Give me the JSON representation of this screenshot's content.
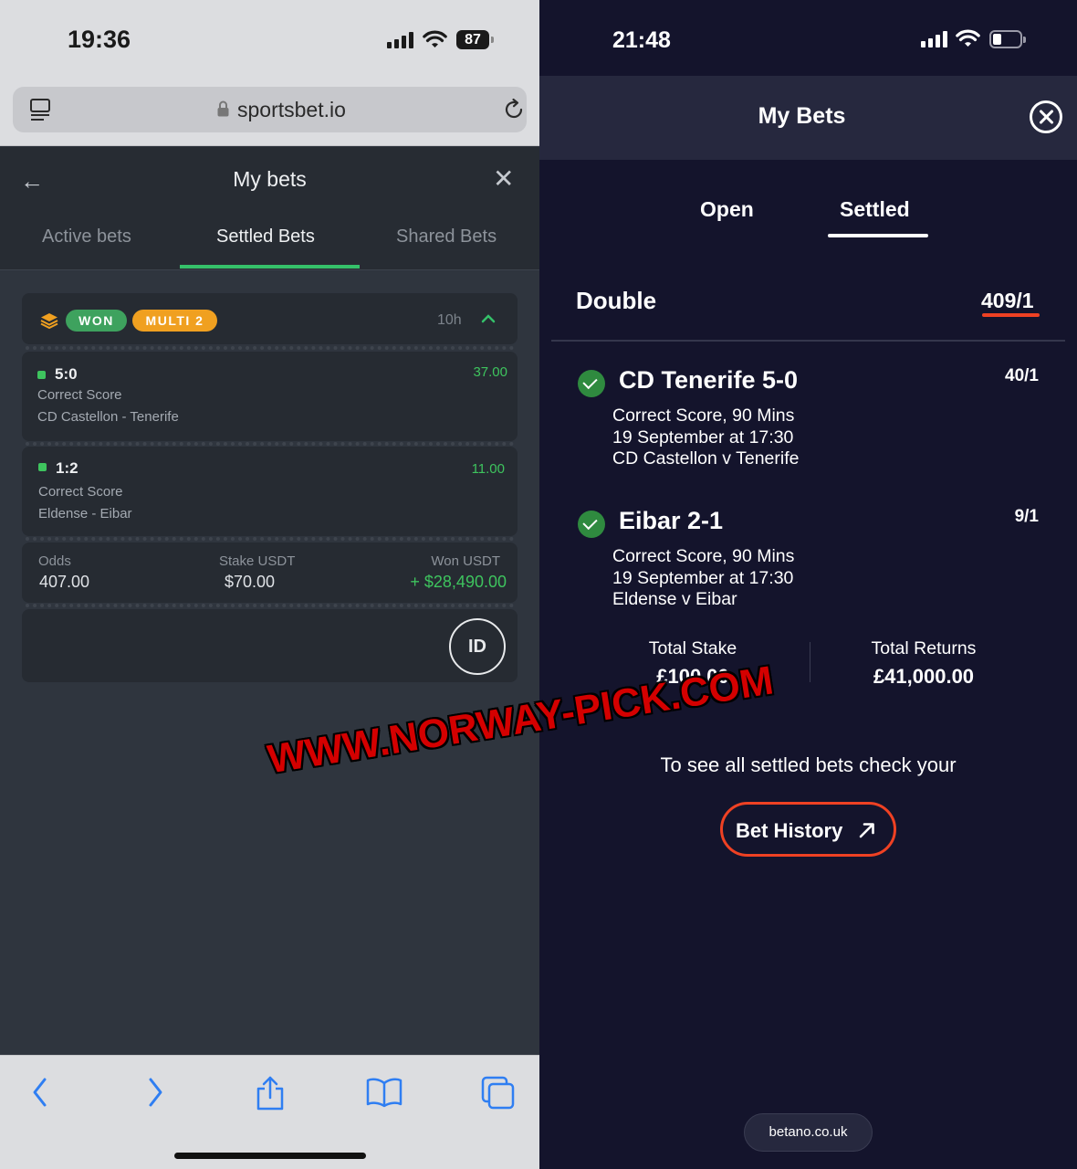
{
  "left": {
    "status": {
      "time": "19:36",
      "battery": "87"
    },
    "browser": {
      "url": "sportsbet.io"
    },
    "header": {
      "title": "My bets"
    },
    "tabs": [
      {
        "label": "Active bets",
        "active": false
      },
      {
        "label": "Settled Bets",
        "active": true
      },
      {
        "label": "Shared Bets",
        "active": false
      }
    ],
    "bet": {
      "status_badge": "WON",
      "type_badge": "MULTI 2",
      "age": "10h",
      "selections": [
        {
          "score": "5:0",
          "market": "Correct Score",
          "match": "CD Castellon - Tenerife",
          "odds": "37.00"
        },
        {
          "score": "1:2",
          "market": "Correct Score",
          "match": "Eldense - Eibar",
          "odds": "11.00"
        }
      ],
      "footer": {
        "odds_label": "Odds",
        "odds_value": "407.00",
        "stake_label": "Stake USDT",
        "stake_value": "$70.00",
        "won_label": "Won USDT",
        "won_value": "+ $28,490.00"
      },
      "id_button": "ID"
    },
    "colors": {
      "accent": "#35c16a",
      "won": "#3ea25e",
      "multi": "#f0a020"
    }
  },
  "right": {
    "status": {
      "time": "21:48"
    },
    "header": {
      "title": "My Bets"
    },
    "tabs": [
      {
        "label": "Open",
        "active": false
      },
      {
        "label": "Settled",
        "active": true
      }
    ],
    "bet": {
      "type": "Double",
      "total_odds": "409/1",
      "legs": [
        {
          "title": "CD Tenerife 5-0",
          "odds": "40/1",
          "market": "Correct Score, 90 Mins",
          "date": "19 September at 17:30",
          "match": "CD Castellon v Tenerife"
        },
        {
          "title": "Eibar 2-1",
          "odds": "9/1",
          "market": "Correct Score, 90 Mins",
          "date": "19 September at 17:30",
          "match": "Eldense v Eibar"
        }
      ],
      "stake_label": "Total Stake",
      "stake_value": "£100.00",
      "returns_label": "Total Returns",
      "returns_value": "£41,000.00"
    },
    "info_text": "To see all settled bets check your",
    "history_button": "Bet History",
    "domain": "betano.co.uk",
    "colors": {
      "accent": "#ef4123",
      "check": "#2f8a3f"
    }
  },
  "watermark": "WWW.NORWAY-PICK.COM"
}
